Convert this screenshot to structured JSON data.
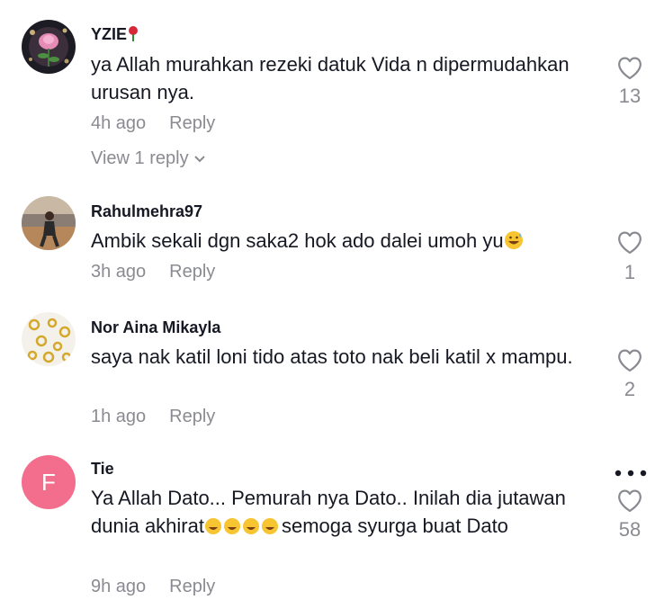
{
  "comments": [
    {
      "username": "YZIE",
      "text": "ya Allah murahkan rezeki datuk Vida n dipermudahkan urusan nya.",
      "time": "4h ago",
      "reply_label": "Reply",
      "view_replies": "View 1 reply",
      "likes": "13"
    },
    {
      "username": "Rahulmehra97",
      "text": "Ambik sekali dgn saka2 hok ado dalei umoh yu",
      "time": "3h ago",
      "reply_label": "Reply",
      "likes": "1"
    },
    {
      "username": "Nor Aina Mikayla",
      "text": "saya nak katil loni tido atas toto nak beli katil x mampu.",
      "time": "1h ago",
      "reply_label": "Reply",
      "likes": "2"
    },
    {
      "username": "Tie",
      "avatar_letter": "F",
      "text_part1": "Ya Allah Dato... Pemurah nya Dato.. Inilah dia jutawan dunia akhirat",
      "text_part2": "semoga syurga buat Dato",
      "time": "9h ago",
      "reply_label": "Reply",
      "likes": "58"
    }
  ],
  "colors": {
    "muted": "#8a8b91",
    "text": "#161823",
    "avatar_pink": "#f26e8c"
  }
}
